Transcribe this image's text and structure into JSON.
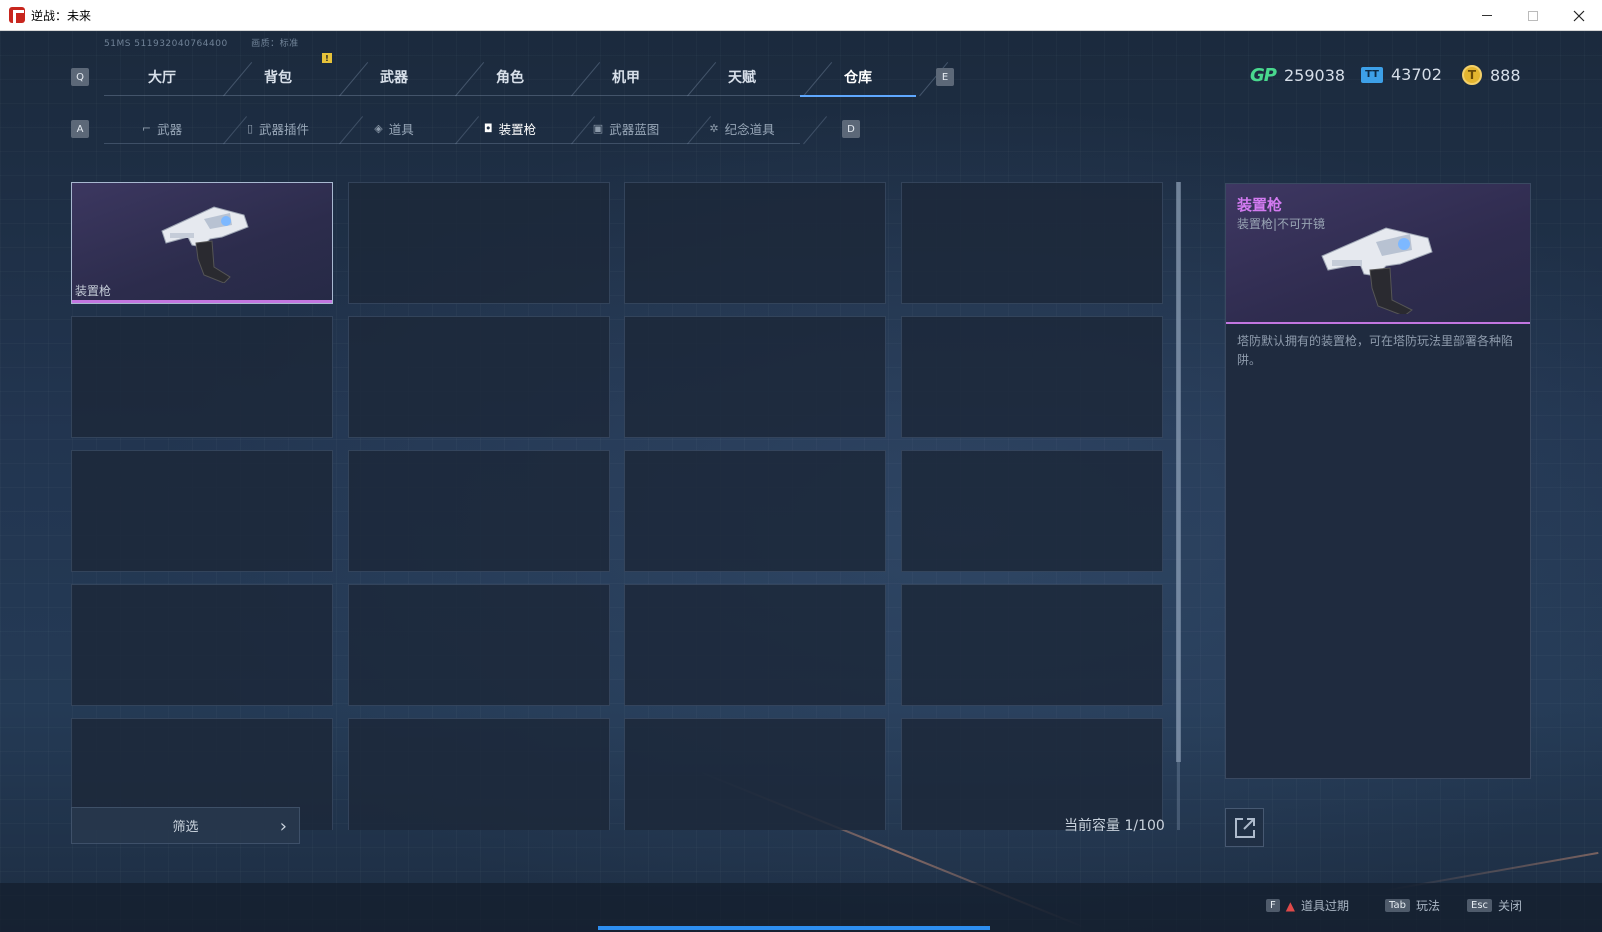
{
  "window": {
    "title": "逆战：未来"
  },
  "system": {
    "id_text": "51MS  511932040764400",
    "quality_text": "画质：标准"
  },
  "main_tabs": {
    "prev_key": "Q",
    "next_key": "E",
    "items": [
      {
        "label": "大厅"
      },
      {
        "label": "背包"
      },
      {
        "label": "武器"
      },
      {
        "label": "角色"
      },
      {
        "label": "机甲"
      },
      {
        "label": "天赋"
      },
      {
        "label": "仓库",
        "active": true
      }
    ],
    "alert_badge": "!"
  },
  "currency": {
    "gp": {
      "icon": "gp-icon",
      "icon_text": "GP",
      "value": "259038"
    },
    "ticket": {
      "icon": "ticket-icon",
      "icon_text": "TT",
      "value": "43702"
    },
    "coin": {
      "icon": "coin-icon",
      "icon_text": "T",
      "value": "888"
    }
  },
  "sub_tabs": {
    "prev_key": "A",
    "next_key": "D",
    "items": [
      {
        "label": "武器",
        "icon": "rifle-icon"
      },
      {
        "label": "武器插件",
        "icon": "plugin-icon"
      },
      {
        "label": "道具",
        "icon": "item-icon"
      },
      {
        "label": "装置枪",
        "icon": "device-gun-icon",
        "active": true
      },
      {
        "label": "武器蓝图",
        "icon": "blueprint-icon"
      },
      {
        "label": "纪念道具",
        "icon": "souvenir-icon"
      }
    ]
  },
  "inventory": {
    "items": [
      {
        "name": "装置枪",
        "rarity_color": "#c276e0"
      }
    ],
    "filter_label": "筛选",
    "capacity_text": "当前容量 1/100"
  },
  "detail": {
    "name": "装置枪",
    "subtitle": "装置枪|不可开镜",
    "description": "塔防默认拥有的装置枪，可在塔防玩法里部署各种陷阱。",
    "name_color": "#d27af0"
  },
  "footer": {
    "expire": {
      "key": "F",
      "label": "道具过期"
    },
    "mode": {
      "key": "Tab",
      "label": "玩法"
    },
    "close": {
      "key": "Esc",
      "label": "关闭"
    }
  }
}
